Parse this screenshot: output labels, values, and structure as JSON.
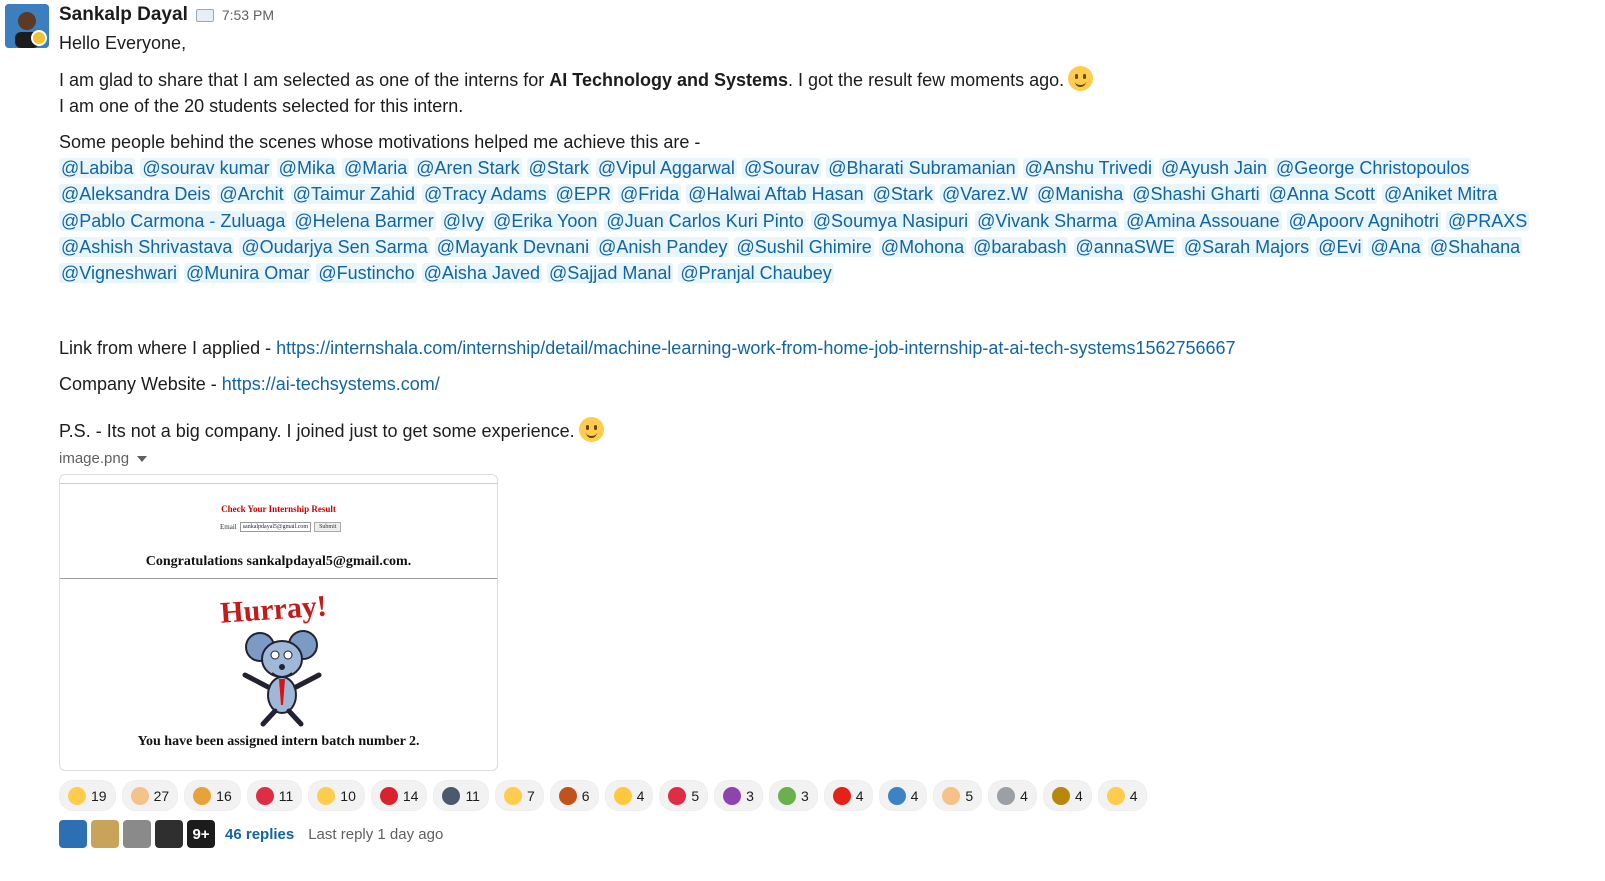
{
  "message": {
    "author": "Sankalp Dayal",
    "time": "7:53 PM",
    "greeting": "Hello Everyone,",
    "line1_pre": "I am glad to share that I am selected as one of the interns for ",
    "line1_bold": "AI Technology and Systems",
    "line1_post": ". I got the result few moments ago.",
    "line2": "I am one of the 20 students selected for this intern.",
    "line3": "Some people behind the scenes whose motivations helped me achieve this are -",
    "mentions": [
      "@Labiba",
      "@sourav kumar",
      "@Mika",
      "@Maria",
      "@Aren Stark",
      "@Stark",
      "@Vipul Aggarwal",
      "@Sourav",
      "@Bharati Subramanian",
      "@Anshu Trivedi",
      "@Ayush Jain",
      "@George Christopoulos",
      "@Aleksandra Deis",
      "@Archit",
      "@Taimur Zahid",
      "@Tracy Adams",
      "@EPR",
      "@Frida",
      "@Halwai Aftab Hasan",
      "@Stark",
      "@Varez.W",
      "@Manisha",
      "@Shashi Gharti",
      "@Anna Scott",
      "@Aniket Mitra",
      "@Pablo Carmona - Zuluaga",
      "@Helena Barmer",
      "@Ivy",
      "@Erika Yoon",
      "@Juan Carlos Kuri Pinto",
      "@Soumya Nasipuri",
      "@Vivank Sharma",
      "@Amina Assouane",
      "@Apoorv Agnihotri",
      "@PRAXS",
      "@Ashish Shrivastava",
      "@Oudarjya Sen Sarma",
      "@Mayank Devnani",
      "@Anish Pandey",
      "@Sushil Ghimire",
      "@Mohona",
      "@barabash",
      "@annaSWE",
      "@Sarah Majors",
      "@Evi",
      "@Ana",
      "@Shahana",
      "@Vigneshwari",
      "@Munira Omar",
      "@Fustincho",
      "@Aisha Javed",
      "@Sajjad Manal",
      "@Pranjal Chaubey"
    ],
    "link_label": "Link from where I applied - ",
    "link_url": "https://internshala.com/internship/detail/machine-learning-work-from-home-job-internship-at-ai-tech-systems1562756667",
    "website_label": "Company Website - ",
    "website_url": "https://ai-techsystems.com/",
    "ps": "P.S. - Its not a big company. I joined just to get some experience."
  },
  "attachment": {
    "filename": "image.png",
    "check_title": "Check Your Internship Result",
    "email_label": "Email",
    "email_value": "sankalpdayal5@gmail.com",
    "submit": "Submit",
    "congrats": "Congratulations sankalpdayal5@gmail.com.",
    "batch": "You have been assigned intern batch number 2."
  },
  "reactions": [
    {
      "icon": "astonished-emoji",
      "count": "19",
      "color": "#ffcc4d"
    },
    {
      "icon": "clap-emoji",
      "count": "27",
      "color": "#f5c28a"
    },
    {
      "icon": "tada-emoji",
      "count": "16",
      "color": "#e8a23a"
    },
    {
      "icon": "heart-emoji",
      "count": "11",
      "color": "#dd2e44"
    },
    {
      "icon": "smile-emoji",
      "count": "10",
      "color": "#ffcc4d"
    },
    {
      "icon": "100-emoji",
      "count": "14",
      "color": "#d9212f"
    },
    {
      "icon": "parrot-emoji",
      "count": "11",
      "color": "#4a5a6a"
    },
    {
      "icon": "heart-eyes-emoji",
      "count": "7",
      "color": "#ffcc4d"
    },
    {
      "icon": "crab-emoji",
      "count": "6",
      "color": "#c1521b"
    },
    {
      "icon": "thumbsup-emoji",
      "count": "4",
      "color": "#ffc83d"
    },
    {
      "icon": "target-emoji",
      "count": "5",
      "color": "#dd2e44"
    },
    {
      "icon": "party-parrot-emoji",
      "count": "3",
      "color": "#8e44ad"
    },
    {
      "icon": "cactus-dance-emoji",
      "count": "3",
      "color": "#6ab04c"
    },
    {
      "icon": "youtube-emoji",
      "count": "4",
      "color": "#e62117"
    },
    {
      "icon": "wave-emoji",
      "count": "4",
      "color": "#3b83c4"
    },
    {
      "icon": "raised-hands-emoji",
      "count": "5",
      "color": "#f5c28a"
    },
    {
      "icon": "loading-emoji",
      "count": "4",
      "color": "#9aa0a6"
    },
    {
      "icon": "dancer-emoji",
      "count": "4",
      "color": "#b8860b"
    },
    {
      "icon": "grinning-emoji",
      "count": "4",
      "color": "#ffcc4d"
    }
  ],
  "thread": {
    "avatar_colors": [
      "#2d6fb3",
      "#c9a35a",
      "#8a8a8a",
      "#2f2f2f"
    ],
    "more": "9+",
    "replies": "46 replies",
    "last_reply": "Last reply 1 day ago"
  }
}
